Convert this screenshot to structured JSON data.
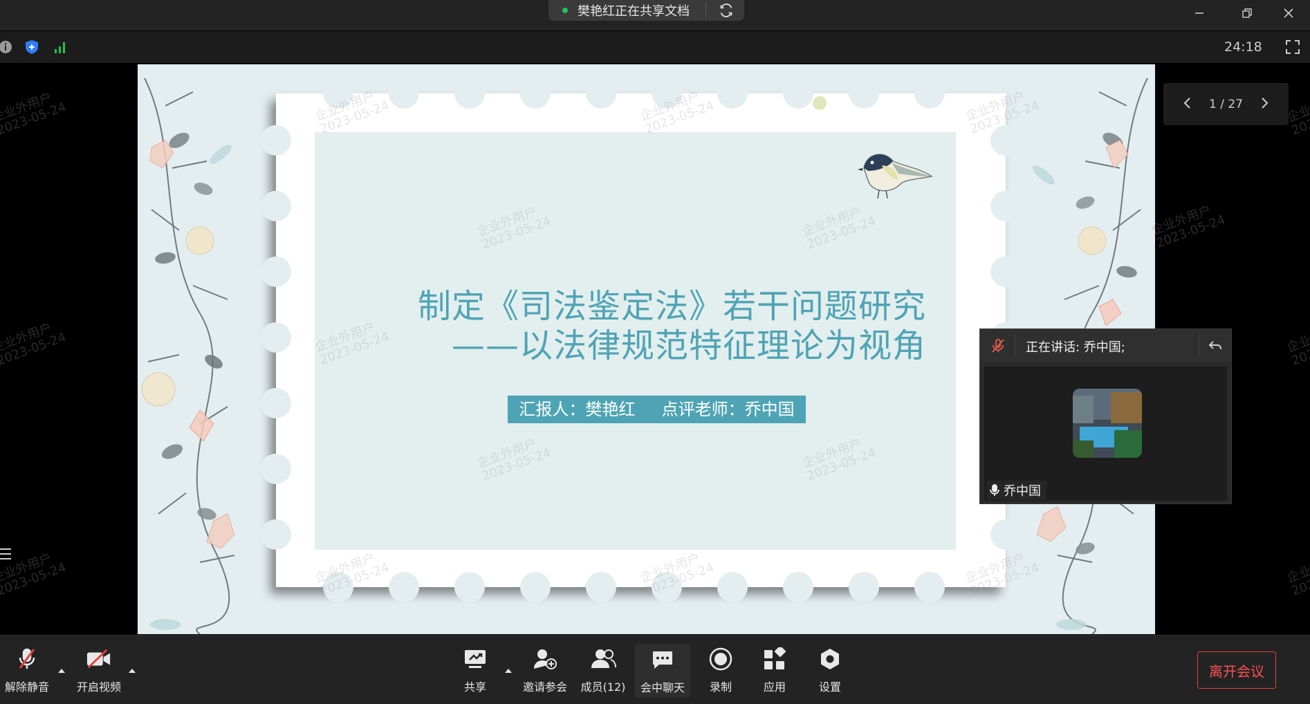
{
  "titlebar": {
    "share_status": "樊艳红正在共享文档",
    "status_color": "#21c35a"
  },
  "infobar": {
    "timer": "24:18",
    "icons": [
      "info-icon",
      "security-shield-icon",
      "network-signal-icon",
      "fullscreen-icon"
    ]
  },
  "watermark": {
    "line1": "企业外用户",
    "line2": "2023-05-24"
  },
  "slide": {
    "title_line1": "制定《司法鉴定法》若干问题研究",
    "title_line2": "——以法律规范特征理论为视角",
    "subtitle": "汇报人：樊艳红     点评老师：乔中国",
    "accent_color": "#4ea4b4"
  },
  "pagenav": {
    "page": "1 / 27"
  },
  "speaker": {
    "speaking_text": "正在讲话: 乔中国;",
    "participant_name": "乔中国"
  },
  "toolbar": {
    "unmute": "解除静音",
    "start_video": "开启视频",
    "share": "共享",
    "invite": "邀请参会",
    "members": "成员(12)",
    "chat": "会中聊天",
    "record": "录制",
    "apps": "应用",
    "settings": "设置",
    "leave": "离开会议",
    "leave_color": "#e34040"
  }
}
